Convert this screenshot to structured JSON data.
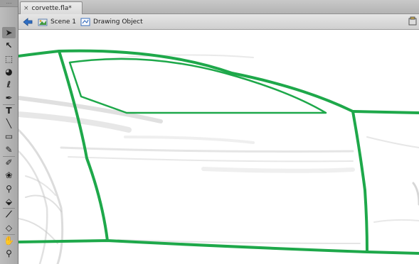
{
  "document": {
    "tab_title": "corvette.fla*",
    "tab_close": "×"
  },
  "editbar": {
    "scene_label": "Scene 1",
    "symbol_label": "Drawing Object"
  },
  "tools": [
    {
      "name": "selection-tool",
      "glyph": "➤",
      "active": true
    },
    {
      "name": "subselection-tool",
      "glyph": "↖"
    },
    {
      "name": "free-transform-tool",
      "glyph": "⬚"
    },
    {
      "name": "3d-rotation-tool",
      "glyph": "◕"
    },
    {
      "name": "lasso-tool",
      "glyph": "ℓ"
    },
    {
      "name": "pen-tool",
      "glyph": "✒"
    },
    {
      "name": "text-tool",
      "glyph": "T"
    },
    {
      "name": "line-tool",
      "glyph": "╲"
    },
    {
      "name": "rectangle-tool",
      "glyph": "▭"
    },
    {
      "name": "pencil-tool",
      "glyph": "✎"
    },
    {
      "name": "brush-tool",
      "glyph": "✐"
    },
    {
      "name": "deco-tool",
      "glyph": "❀"
    },
    {
      "name": "bone-tool",
      "glyph": "⚲"
    },
    {
      "name": "paint-bucket-tool",
      "glyph": "⬙"
    },
    {
      "name": "eyedropper-tool",
      "glyph": "⟋"
    },
    {
      "name": "eraser-tool",
      "glyph": "◇"
    },
    {
      "name": "hand-tool",
      "glyph": "✋"
    },
    {
      "name": "zoom-tool",
      "glyph": "⚲"
    }
  ],
  "colors": {
    "stroke": "#1ea84a",
    "sketch": "#b8b8b8"
  }
}
